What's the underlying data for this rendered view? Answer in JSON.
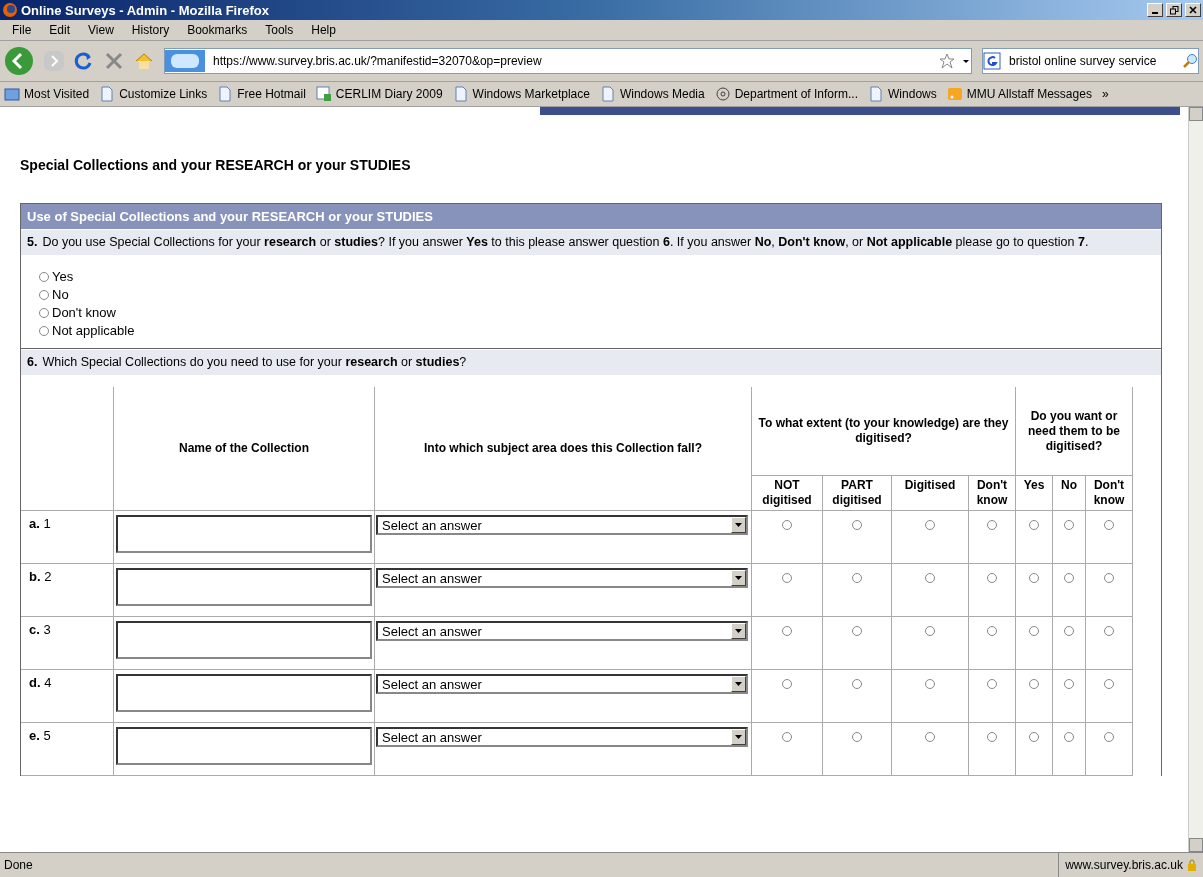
{
  "window": {
    "title": "Online Surveys - Admin - Mozilla Firefox"
  },
  "menu": [
    "File",
    "Edit",
    "View",
    "History",
    "Bookmarks",
    "Tools",
    "Help"
  ],
  "address_bar": {
    "value": "https://www.survey.bris.ac.uk/?manifestid=32070&op=preview"
  },
  "search_bar": {
    "value": "bristol online survey service"
  },
  "bookmarks": [
    {
      "label": "Most Visited",
      "kind": "folder"
    },
    {
      "label": "Customize Links",
      "kind": "page"
    },
    {
      "label": "Free Hotmail",
      "kind": "page"
    },
    {
      "label": "CERLIM Diary 2009",
      "kind": "sheet"
    },
    {
      "label": "Windows Marketplace",
      "kind": "page"
    },
    {
      "label": "Windows Media",
      "kind": "page"
    },
    {
      "label": "Department of Inform...",
      "kind": "emblem"
    },
    {
      "label": "Windows",
      "kind": "page"
    },
    {
      "label": "MMU Allstaff Messages",
      "kind": "feed"
    }
  ],
  "bookmarks_overflow": "»",
  "page": {
    "heading": "Special Collections and your RESEARCH or your STUDIES",
    "section_title": "Use of Special Collections and your RESEARCH or your STUDIES",
    "question_5": {
      "number": "5.",
      "text": "Do you use Special Collections for your **research** or **studies**? If you answer **Yes** to this please answer question **6**. If you answer **No**, **Don't know**, or **Not applicable** please go to question **7**.",
      "options": [
        {
          "label": "Yes",
          "selected": false
        },
        {
          "label": "No",
          "selected": false
        },
        {
          "label": "Don't know",
          "selected": false
        },
        {
          "label": "Not applicable",
          "selected": false
        }
      ]
    },
    "question_6": {
      "number": "6.",
      "text": "Which Special Collections do you need to use for your **research** or **studies**?",
      "table": {
        "columns": [
          "Name of the Collection",
          "Into which subject area does this Collection fall?"
        ],
        "groups": [
          {
            "title": "To what extent (to your knowledge) are they digitised?",
            "subcolumns": [
              "NOT digitised",
              "PART digitised",
              "Digitised",
              "Don't know"
            ]
          },
          {
            "title": "Do you want or need them to be digitised?",
            "subcolumns": [
              "Yes",
              "No",
              "Don't know"
            ]
          }
        ],
        "rows": [
          {
            "label": "**a.** 1",
            "select": "Select an answer",
            "choices": [
              false,
              false,
              false,
              false,
              false,
              false,
              false
            ]
          },
          {
            "label": "**b.** 2",
            "select": "Select an answer",
            "choices": [
              false,
              false,
              false,
              false,
              false,
              false,
              false
            ]
          },
          {
            "label": "**c.** 3",
            "select": "Select an answer",
            "choices": [
              false,
              false,
              false,
              false,
              false,
              false,
              false
            ]
          },
          {
            "label": "**d.** 4",
            "select": "Select an answer",
            "choices": [
              false,
              false,
              false,
              false,
              false,
              false,
              false
            ]
          },
          {
            "label": "**e.** 5",
            "select": "Select an answer",
            "choices": [
              false,
              false,
              false,
              false,
              false,
              false,
              false
            ]
          }
        ]
      }
    }
  },
  "status_bar": {
    "text": "Done",
    "host": "www.survey.bris.ac.uk"
  }
}
